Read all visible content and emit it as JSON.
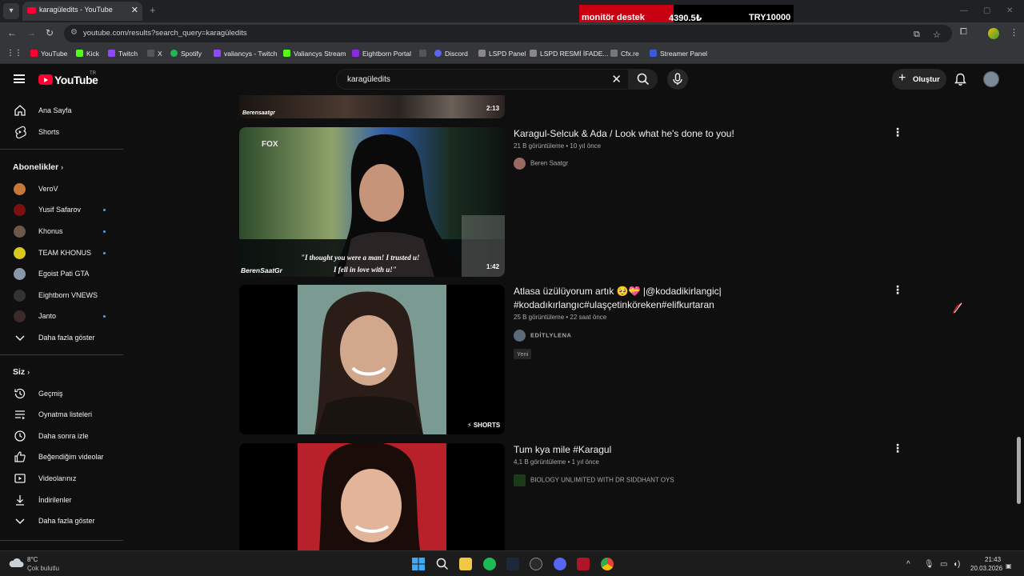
{
  "browser": {
    "tab_title": "karagüledits - YouTube",
    "url": "youtube.com/results?search_query=karagüledits",
    "bookmarks": [
      "YouTube",
      "Kick",
      "Twitch",
      "X",
      "Spotify",
      "valiancys - Twitch",
      "Valiancys Stream",
      "Eightborn Portal",
      "Discord",
      "LSPD Panel",
      "LSPD  RESMİ İFADE...",
      "Cfx.re",
      "Streamer Panel"
    ]
  },
  "stream_overlay": {
    "label": "monitör destek",
    "amount": "4390.5₺",
    "goal": "TRY10000"
  },
  "youtube": {
    "logo": "YouTube",
    "logo_suffix": "TR",
    "search_query": "karagüledits",
    "create_label": "Oluştur"
  },
  "sidebar": {
    "main": [
      {
        "label": "Ana Sayfa",
        "icon": "home-icon"
      },
      {
        "label": "Shorts",
        "icon": "shorts-icon"
      }
    ],
    "subs_title": "Abonelikler",
    "subs": [
      {
        "label": "VeroV",
        "dot": false,
        "color": "#c8763a"
      },
      {
        "label": "Yusif Safarov",
        "dot": true,
        "color": "#7a1010"
      },
      {
        "label": "Khonus",
        "dot": true,
        "color": "#6b5a4a"
      },
      {
        "label": "TEAM KHONUS",
        "dot": true,
        "color": "#d8c820"
      },
      {
        "label": "Egoist Pati GTA",
        "dot": false,
        "color": "#8898a8"
      },
      {
        "label": "Eightborn VNEWS",
        "dot": false,
        "color": "#333333"
      },
      {
        "label": "Janto",
        "dot": true,
        "color": "#3a2a2a"
      }
    ],
    "subs_more": "Daha fazla göster",
    "you_title": "Siz",
    "you": [
      {
        "label": "Geçmiş",
        "icon": "history-icon"
      },
      {
        "label": "Oynatma listeleri",
        "icon": "playlists-icon"
      },
      {
        "label": "Daha sonra izle",
        "icon": "watch-later-icon"
      },
      {
        "label": "Beğendiğim videolar",
        "icon": "liked-icon"
      },
      {
        "label": "Videolarınız",
        "icon": "your-videos-icon"
      },
      {
        "label": "İndirilenler",
        "icon": "downloads-icon"
      }
    ],
    "you_more": "Daha fazla göster"
  },
  "results": [
    {
      "title": "Karagul-Selcuk & Ada / Look what he's done to you!",
      "meta": "21 B görüntüleme • 10 yıl önce",
      "channel": "Beren Saatgr",
      "duration": "1:42",
      "thumb_caption_1": "\"I thought you were a man! I trusted u!",
      "thumb_caption_2": "I fell in love with u!\"",
      "thumb_watermark": "BerenSaatGr",
      "thumb_logo": "FOX"
    },
    {
      "title": "Atlasa üzülüyorum artık 🥺💝 |@kodadikirlangic| #kodadıkırlangıc#ulaşçetinköreken#elifkurtaran",
      "meta": "25 B görüntüleme • 22 saat önce",
      "channel": "EDİTLYLENA",
      "badge": "Yeni",
      "shorts_label": "SHORTS"
    },
    {
      "title": "Tum kya mile #Karagul",
      "meta": "4,1 B görüntüleme • 1 yıl önce",
      "channel": "BIOLOGY UNLIMITED WITH DR SIDDHANT OYS"
    }
  ],
  "partial_top": {
    "duration": "2:13",
    "watermark": "Berensaatgr"
  },
  "taskbar": {
    "weather_temp": "8°C",
    "weather_text": "Çok bulutlu",
    "time": "21:43",
    "date": "20.03.2026"
  }
}
